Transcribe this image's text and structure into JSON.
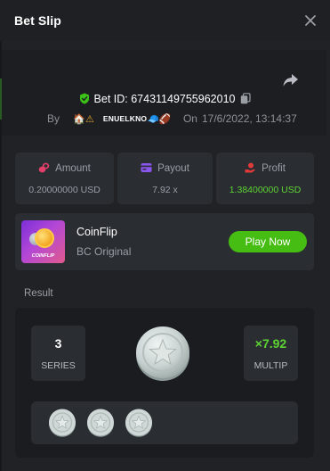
{
  "modal": {
    "title": "Bet Slip"
  },
  "bet": {
    "id_label": "Bet ID: 67431149755962010",
    "by_label": "By",
    "username": "ENUELKNO",
    "on_label": "On",
    "datetime": "17/6/2022, 13:14:37"
  },
  "stats": [
    {
      "label": "Amount",
      "value": "0.20000000 USD",
      "icon": "coins-icon",
      "icon_color": "#e2406a"
    },
    {
      "label": "Payout",
      "value": "7.92 x",
      "icon": "payout-icon",
      "icon_color": "#8c55f0"
    },
    {
      "label": "Profit",
      "value": "1.38400000 USD",
      "icon": "profit-icon",
      "icon_color": "#e03a3a",
      "value_color": "#5dd332"
    }
  ],
  "game": {
    "thumb_text": "COINFLIP",
    "name": "CoinFlip",
    "publisher": "BC Original",
    "play_label": "Play Now"
  },
  "result": {
    "section_label": "Result",
    "series_value": "3",
    "series_label": "SERIES",
    "multiplier_value": "×7.92",
    "multiplier_label": "MULTIP",
    "history_count": 3
  },
  "colors": {
    "accent_green": "#46bd12",
    "text_green": "#5dd332",
    "panel": "#202226",
    "card": "#2a2d32"
  }
}
